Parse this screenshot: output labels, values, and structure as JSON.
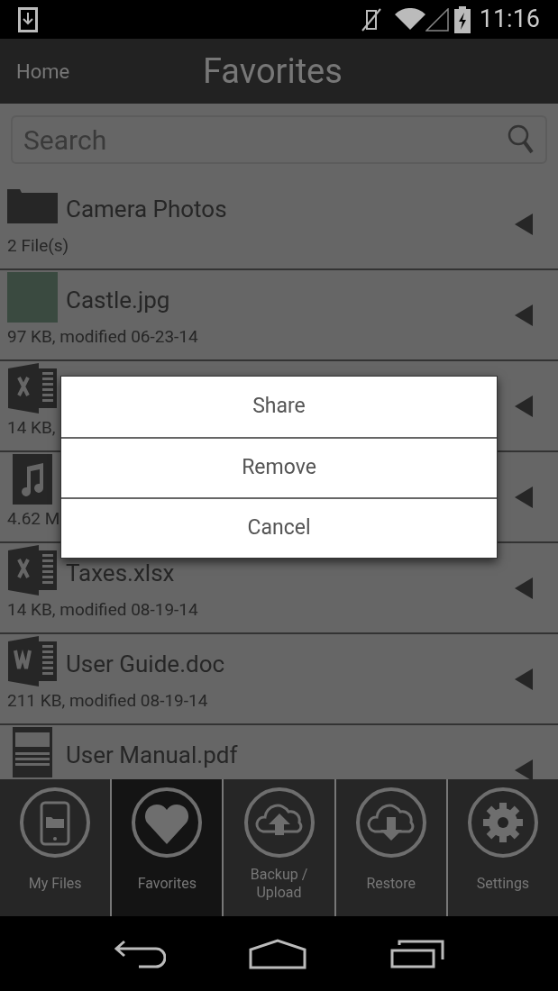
{
  "status_bar": {
    "time": "11:16"
  },
  "header": {
    "back": "Home",
    "title": "Favorites"
  },
  "search": {
    "placeholder": "Search"
  },
  "rows": [
    {
      "kind": "folder",
      "name": "Camera Photos",
      "subtitle": "2 File(s)"
    },
    {
      "kind": "image",
      "name": "Castle.jpg",
      "subtitle": "97 KB, modified 06-23-14"
    },
    {
      "kind": "excel",
      "subtitle": "14 KB,"
    },
    {
      "kind": "music",
      "subtitle": "4.62 M"
    },
    {
      "kind": "excel",
      "name": "Taxes.xlsx",
      "subtitle": "14 KB, modified 08-19-14"
    },
    {
      "kind": "word",
      "name": "User Guide.doc",
      "subtitle": "211 KB, modified 08-19-14"
    },
    {
      "kind": "pdf",
      "name": "User Manual.pdf"
    }
  ],
  "dialog": {
    "items": [
      "Share",
      "Remove",
      "Cancel"
    ]
  },
  "tabs": [
    {
      "kind": "phone",
      "label": "My Files",
      "selected": false
    },
    {
      "kind": "heart",
      "label": "Favorites",
      "selected": true
    },
    {
      "kind": "upload",
      "label": "Backup /\nUpload",
      "selected": false
    },
    {
      "kind": "download",
      "label": "Restore",
      "selected": false
    },
    {
      "kind": "gear",
      "label": "Settings",
      "selected": false
    }
  ]
}
